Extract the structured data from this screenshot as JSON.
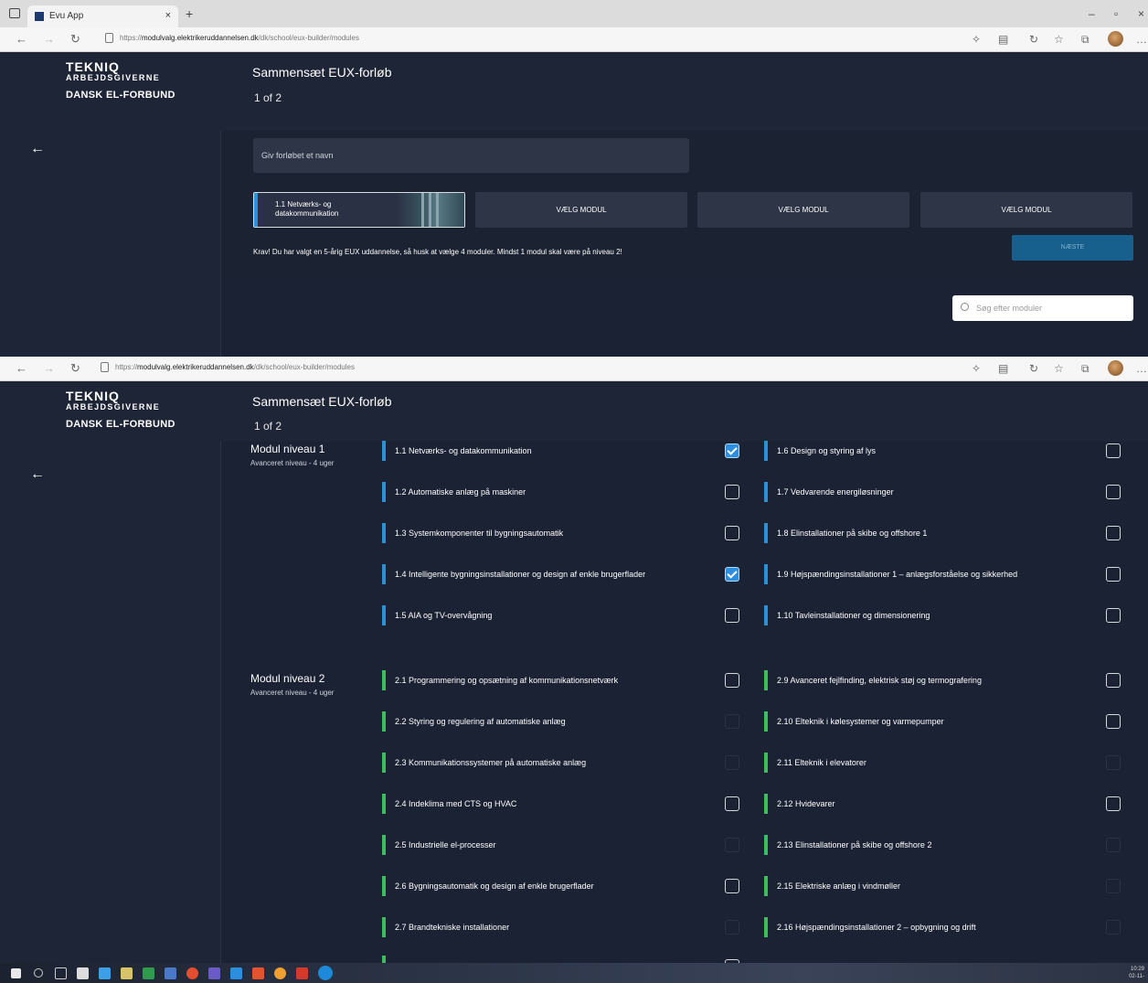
{
  "browser": {
    "tab_title": "Evu App",
    "tab_close": "×",
    "new_tab": "+",
    "minimize": "–",
    "maximize": "▫",
    "close": "×",
    "url_prefix": "https://",
    "url_host": "modulvalg.elektrikeruddannelsen.dk",
    "url_path": "/dk/school/eux-builder/modules"
  },
  "app": {
    "logo_line1": "TEKNIQ",
    "logo_line2": "ARBEJDSGIVERNE",
    "logo_line3": "DANSK EL-FORBUND",
    "title": "Sammensæt EUX-forløb",
    "step": "1 of 2",
    "back_icon": "←"
  },
  "builder": {
    "name_placeholder": "Giv forløbet et navn",
    "selected_slot": "1.1 Netværks- og datakommunikation",
    "empty_slot_label": "VÆLG MODUL",
    "requirement": "Krav! Du har valgt en 5-årig EUX uddannelse, så husk at vælge 4 moduler. Mindst 1 modul skal være på niveau 2!",
    "next_label": "NÆSTE",
    "search_placeholder": "Søg efter moduler"
  },
  "groups": [
    {
      "title": "Modul niveau 1",
      "subtitle": "Avanceret niveau - 4 uger"
    },
    {
      "title": "Modul niveau 2",
      "subtitle": "Avanceret niveau - 4 uger"
    }
  ],
  "level1_left": [
    {
      "label": "1.1 Netværks- og datakommunikation",
      "state": "checked"
    },
    {
      "label": "1.2 Automatiske anlæg på maskiner",
      "state": "empty"
    },
    {
      "label": "1.3 Systemkomponenter til bygningsautomatik",
      "state": "empty"
    },
    {
      "label": "1.4 Intelligente bygningsinstallationer og design af enkle brugerflader",
      "state": "checked"
    },
    {
      "label": "1.5 AIA og TV-overvågning",
      "state": "empty"
    }
  ],
  "level1_right": [
    {
      "label": "1.6 Design og styring af lys",
      "state": "empty"
    },
    {
      "label": "1.7 Vedvarende energiløsninger",
      "state": "empty"
    },
    {
      "label": "1.8 Elinstallationer på skibe og offshore 1",
      "state": "empty"
    },
    {
      "label": "1.9 Højspændingsinstallationer 1 – anlægsforståelse og sikkerhed",
      "state": "empty"
    },
    {
      "label": "1.10 Tavleinstallationer og dimensionering",
      "state": "empty"
    }
  ],
  "level2_left": [
    {
      "label": "2.1 Programmering og opsætning af kommunikationsnetværk",
      "state": "empty"
    },
    {
      "label": "2.2 Styring og regulering af automatiske anlæg",
      "state": "disabled"
    },
    {
      "label": "2.3 Kommunikationssystemer på automatiske anlæg",
      "state": "disabled"
    },
    {
      "label": "2.4 Indeklima med CTS og HVAC",
      "state": "empty"
    },
    {
      "label": "2.5 Industrielle el-processer",
      "state": "disabled"
    },
    {
      "label": "2.6 Bygningsautomatik og design af enkle brugerflader",
      "state": "empty"
    },
    {
      "label": "2.7 Brandtekniske installationer",
      "state": "disabled"
    }
  ],
  "level2_right": [
    {
      "label": "2.9 Avanceret fejlfinding, elektrisk støj og termografering",
      "state": "empty"
    },
    {
      "label": "2.10 Elteknik i kølesystemer og varmepumper",
      "state": "empty"
    },
    {
      "label": "2.11 Elteknik i elevatorer",
      "state": "disabled"
    },
    {
      "label": "2.12 Hvidevarer",
      "state": "empty"
    },
    {
      "label": "2.13 Elinstallationer på skibe og offshore 2",
      "state": "disabled"
    },
    {
      "label": "2.15 Elektriske anlæg i vindmøller",
      "state": "disabled"
    },
    {
      "label": "2.16 Højspændingsinstallationer 2 – opbygning og drift",
      "state": "disabled"
    }
  ],
  "colors": {
    "level1_bar": "#2d8fd4",
    "level2_bar": "#3dbd5c",
    "check_on": "#2e8ee0"
  },
  "taskbar": {
    "time": "10:29",
    "date": "02-11-"
  }
}
